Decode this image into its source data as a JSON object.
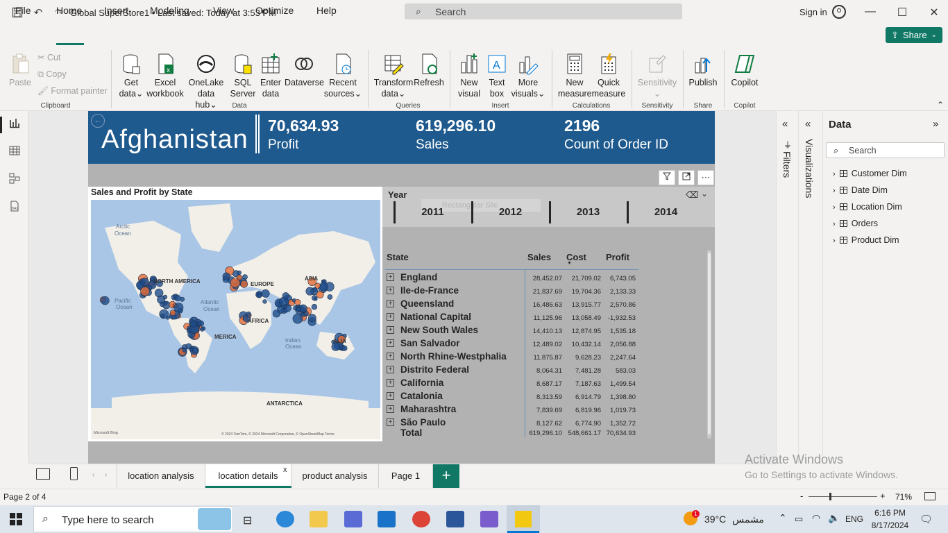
{
  "titlebar": {
    "doc_title": "Global SuperStore1 • Last saved: Today at 3:53 PM",
    "search_placeholder": "Search",
    "signin": "Sign in"
  },
  "menu": [
    "File",
    "Home",
    "Insert",
    "Modeling",
    "View",
    "Optimize",
    "Help"
  ],
  "share_label": "Share",
  "ribbon": {
    "clipboard": {
      "paste": "Paste",
      "cut": "Cut",
      "copy": "Copy",
      "format_painter": "Format painter",
      "group": "Clipboard"
    },
    "data": {
      "get_data": [
        "Get",
        "data"
      ],
      "excel": [
        "Excel",
        "workbook"
      ],
      "onelake": [
        "OneLake",
        "data hub"
      ],
      "sql": [
        "SQL",
        "Server"
      ],
      "enter": [
        "Enter",
        "data"
      ],
      "dataverse": [
        "Dataverse",
        ""
      ],
      "recent": [
        "Recent",
        "sources"
      ],
      "group": "Data"
    },
    "queries": {
      "transform": [
        "Transform",
        "data"
      ],
      "refresh": [
        "Refresh",
        ""
      ],
      "group": "Queries"
    },
    "insert": {
      "new_visual": [
        "New",
        "visual"
      ],
      "text_box": [
        "Text",
        "box"
      ],
      "more_visuals": [
        "More",
        "visuals"
      ],
      "group": "Insert"
    },
    "calculations": {
      "new_measure": [
        "New",
        "measure"
      ],
      "quick_measure": [
        "Quick",
        "measure"
      ],
      "group": "Calculations"
    },
    "sensitivity": {
      "label": "Sensitivity",
      "group": "Sensitivity"
    },
    "share": {
      "publish": "Publish",
      "group": "Share"
    },
    "copilot": {
      "label": "Copilot",
      "group": "Copilot"
    }
  },
  "banner": {
    "country": "Afghanistan",
    "kpis": [
      {
        "value": "70,634.93",
        "label": "Profit"
      },
      {
        "value": "619,296.10",
        "label": "Sales"
      },
      {
        "value": "2196",
        "label": "Count of Order ID"
      }
    ]
  },
  "map": {
    "title": "Sales and Profit by State",
    "labels": {
      "arctic": [
        "Arctic",
        "Ocean"
      ],
      "pacific": [
        "Pacific",
        "Ocean"
      ],
      "atlantic": [
        "Atlantic",
        "Ocean"
      ],
      "indian": [
        "Indian",
        "Ocean"
      ],
      "north_america": "NORTH AMERICA",
      "europe": "EUROPE",
      "asia": "ASIA",
      "africa": "AFRICA",
      "south_america": "MERICA",
      "australia": "ALIA",
      "antarctica": "ANTARCTICA"
    },
    "attribution": "© 2024 TomTom, © 2024 Microsoft Corporation, © OpenStreetMap  Terms",
    "bing": "Microsoft Bing",
    "colors": {
      "dot_blue": "#1f4e8c",
      "dot_orange": "#e66c37",
      "water": "#aac6e6",
      "land": "#f1efe8"
    }
  },
  "slicer": {
    "title": "Year",
    "ghost": "Rectangular Slic",
    "years": [
      "2011",
      "2012",
      "2013",
      "2014"
    ]
  },
  "table": {
    "headers": {
      "state": "State",
      "sales": "Sales",
      "cost": "Cost",
      "profit": "Profit"
    },
    "rows": [
      {
        "state": "England",
        "sales": "28,452.07",
        "cost": "21,709.02",
        "profit": "6,743.05"
      },
      {
        "state": "Ile-de-France",
        "sales": "21,837.69",
        "cost": "19,704.36",
        "profit": "2,133.33"
      },
      {
        "state": "Queensland",
        "sales": "16,486.63",
        "cost": "13,915.77",
        "profit": "2,570.86"
      },
      {
        "state": "National Capital",
        "sales": "11,125.96",
        "cost": "13,058.49",
        "profit": "-1,932.53"
      },
      {
        "state": "New South Wales",
        "sales": "14,410.13",
        "cost": "12,874.95",
        "profit": "1,535.18"
      },
      {
        "state": "San Salvador",
        "sales": "12,489.02",
        "cost": "10,432.14",
        "profit": "2,056.88"
      },
      {
        "state": "North Rhine-Westphalia",
        "sales": "11,875.87",
        "cost": "9,628.23",
        "profit": "2,247.64"
      },
      {
        "state": "Distrito Federal",
        "sales": "8,064.31",
        "cost": "7,481.28",
        "profit": "583.03"
      },
      {
        "state": "California",
        "sales": "8,687.17",
        "cost": "7,187.63",
        "profit": "1,499.54"
      },
      {
        "state": "Catalonia",
        "sales": "8,313.59",
        "cost": "6,914.79",
        "profit": "1,398.80"
      },
      {
        "state": "Maharashtra",
        "sales": "7,839.69",
        "cost": "6,819.96",
        "profit": "1,019.73"
      },
      {
        "state": "São Paulo",
        "sales": "8,127.62",
        "cost": "6,774.90",
        "profit": "1,352.72"
      }
    ],
    "total": {
      "label": "Total",
      "sales": "619,296.10",
      "cost": "548,661.17",
      "profit": "70,634.93"
    }
  },
  "panes": {
    "filters": "Filters",
    "visualizations": "Visualizations",
    "data_title": "Data",
    "data_search": "Search",
    "tables": [
      "Customer Dim",
      "Date Dim",
      "Location Dim",
      "Orders",
      "Product Dim"
    ]
  },
  "pages": [
    "location analysis",
    "location details",
    "product analysis",
    "Page 1"
  ],
  "active_page": "location details",
  "status": {
    "page": "Page 2 of 4",
    "zoom": "71%"
  },
  "watermark": {
    "line1": "Activate Windows",
    "line2": "Go to Settings to activate Windows."
  },
  "taskbar": {
    "search": "Type here to search",
    "weather": "39°C",
    "weather_text": "مشمس",
    "lang": "ENG",
    "time": "6:16 PM",
    "date": "8/17/2024",
    "weather_badge": "1"
  }
}
